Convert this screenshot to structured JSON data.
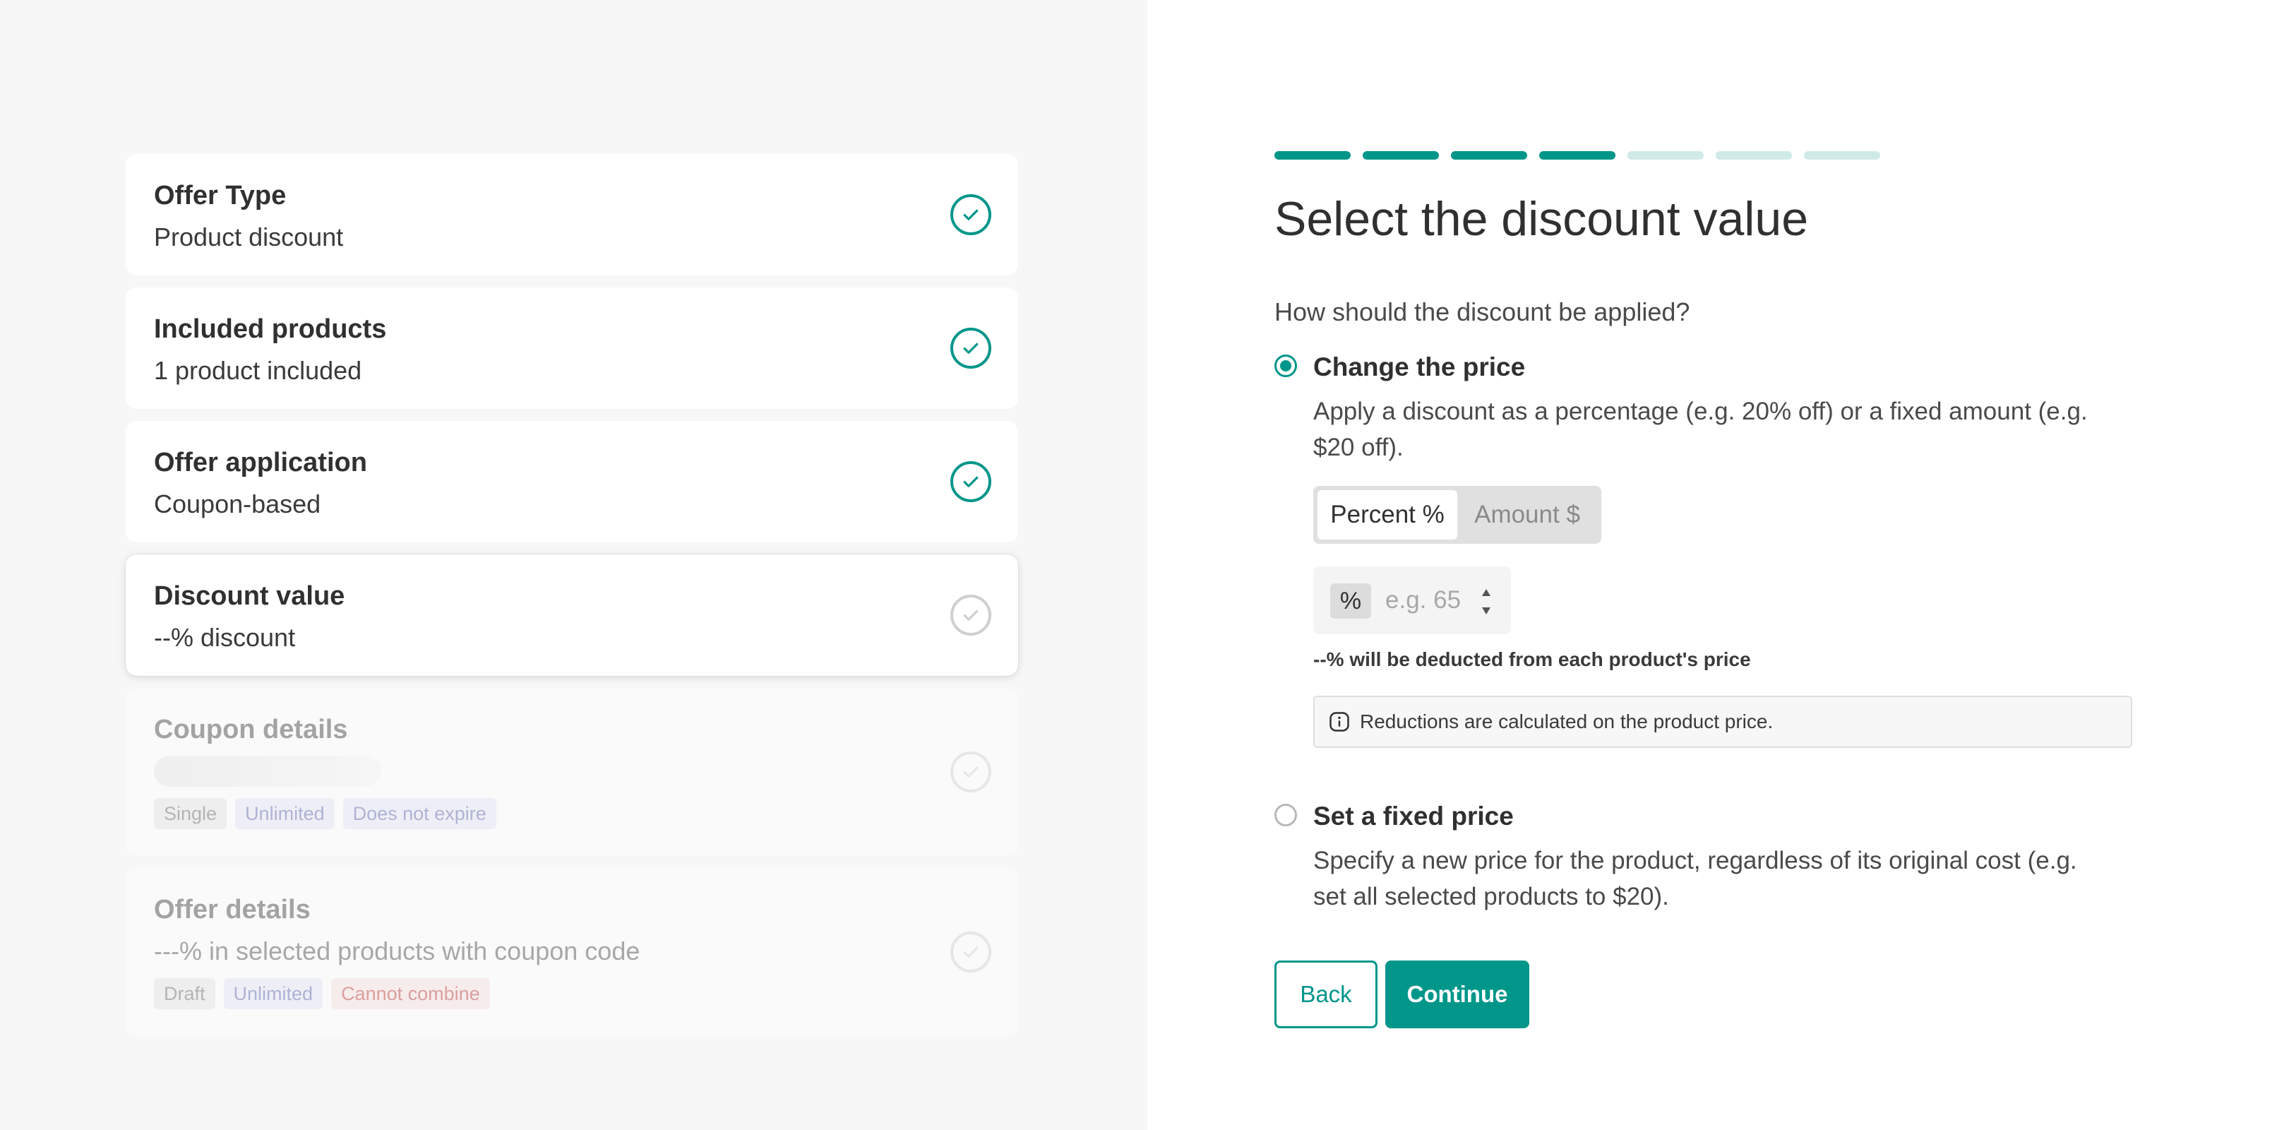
{
  "colors": {
    "accent": "#00968a",
    "progress_inactive": "#cfeae7",
    "badge_red_text": "#b52525",
    "badge_blue_text": "#4a56a8"
  },
  "steps": [
    {
      "title": "Offer Type",
      "subtitle": "Product discount",
      "status": "complete"
    },
    {
      "title": "Included products",
      "subtitle": "1 product included",
      "status": "complete"
    },
    {
      "title": "Offer application",
      "subtitle": "Coupon-based",
      "status": "complete"
    },
    {
      "title": "Discount value",
      "subtitle": "--% discount",
      "status": "active"
    },
    {
      "title": "Coupon details",
      "subtitle": "",
      "status": "upcoming",
      "badges": [
        "Single",
        "Unlimited",
        "Does not expire"
      ]
    },
    {
      "title": "Offer details",
      "subtitle": "---% in selected products with coupon code",
      "status": "upcoming",
      "badges": [
        "Draft",
        "Unlimited",
        "Cannot combine"
      ]
    }
  ],
  "progress": {
    "completed": 4,
    "total": 7
  },
  "main": {
    "heading": "Select the discount value",
    "question": "How should the discount be applied?",
    "options": [
      {
        "title": "Change the price",
        "description": "Apply a discount as a percentage (e.g. 20% off) or a fixed amount (e.g. $20 off).",
        "selected": true
      },
      {
        "title": "Set a fixed price",
        "description": "Specify a new price for the product, regardless of its original cost (e.g. set all selected products to $20).",
        "selected": false
      }
    ],
    "toggle": {
      "percent_label": "Percent %",
      "amount_label": "Amount $",
      "selected": "percent"
    },
    "input": {
      "prefix": "%",
      "placeholder": "e.g. 65",
      "value": ""
    },
    "hint": "--% will be deducted from each product's price",
    "info": "Reductions are calculated on the product price."
  },
  "buttons": {
    "back": "Back",
    "continue": "Continue"
  }
}
